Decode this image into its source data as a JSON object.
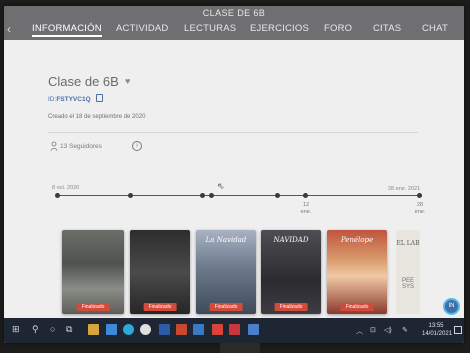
{
  "window": {
    "title": "CLASE DE 6B"
  },
  "tabs": [
    {
      "label": "INFORMACIÓN",
      "active": true
    },
    {
      "label": "ACTIVIDAD"
    },
    {
      "label": "LECTURAS"
    },
    {
      "label": "EJERCICIOS"
    },
    {
      "label": "FORO"
    },
    {
      "label": "CITAS"
    },
    {
      "label": "CHAT"
    }
  ],
  "class": {
    "name": "Clase de 6B",
    "id_prefix": "ID:",
    "id_value": "FSTYVC1Q",
    "created": "Creado el 18 de septiembre de 2020",
    "followers": "13 Seguidores"
  },
  "timeline": {
    "start_label": "8 oct. 2020",
    "end_label": "28 ene. 2021",
    "sub_labels": [
      {
        "day": "12",
        "month": "ene."
      },
      {
        "day": "28",
        "month": "ene."
      }
    ]
  },
  "books": [
    {
      "title": "",
      "badge": "Finalizado"
    },
    {
      "title": "",
      "badge": "Finalizado"
    },
    {
      "title": "La Navidad",
      "badge": "Finalizado"
    },
    {
      "title": "NAVIDAD",
      "badge": "Finalizado"
    },
    {
      "title": "Penélope",
      "badge": "Finalizado"
    },
    {
      "title": "EL LAB",
      "side": "PEE SYS"
    }
  ],
  "fab": {
    "label": "IN"
  },
  "taskbar": {
    "time": "13:55",
    "date": "14/01/2021"
  },
  "colors": {
    "topbar": "#6f6f72",
    "badge": "#d24a3a",
    "link": "#4a6fa8",
    "taskbar": "#1e2633"
  }
}
